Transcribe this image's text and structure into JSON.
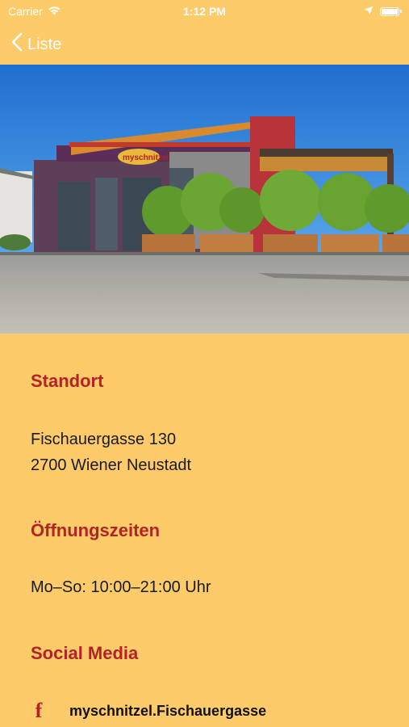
{
  "status_bar": {
    "carrier": "Carrier",
    "time": "1:12 PM"
  },
  "nav": {
    "back_label": "Liste"
  },
  "hero": {
    "sign_text": "myschnitzel"
  },
  "location": {
    "title": "Standort",
    "street": "Fischauergasse 130",
    "city": "2700 Wiener Neustadt"
  },
  "hours": {
    "title": "Öffnungszeiten",
    "text": "Mo–So: 10:00–21:00 Uhr"
  },
  "social": {
    "title": "Social Media",
    "facebook_label": "myschnitzel.Fischauergasse",
    "facebook_icon": "facebook-icon"
  },
  "colors": {
    "background": "#FECB6A",
    "accent": "#B32224"
  }
}
